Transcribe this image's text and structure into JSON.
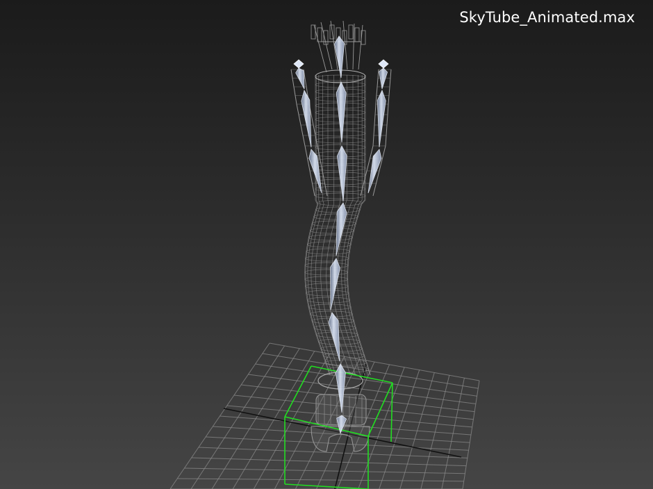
{
  "viewport": {
    "file_title": "SkyTube_Animated.max",
    "colors": {
      "background_top": "#1b1b1b",
      "background_bottom": "#454545",
      "wireframe": "#9a9a9a",
      "grid": "#8a8a8a",
      "grid_axis": "#111111",
      "bone": "#c8d4ea",
      "selection_box": "#22dd22"
    },
    "objects": [
      {
        "name": "SkyTube",
        "kind": "wireframe-mesh"
      },
      {
        "name": "bone-chain-main",
        "kind": "bones",
        "count": 8
      },
      {
        "name": "bone-chain-left",
        "kind": "bones",
        "count": 3
      },
      {
        "name": "bone-chain-right",
        "kind": "bones",
        "count": 3
      },
      {
        "name": "base-selection",
        "kind": "selection-bounding-box",
        "selected": true
      }
    ]
  }
}
